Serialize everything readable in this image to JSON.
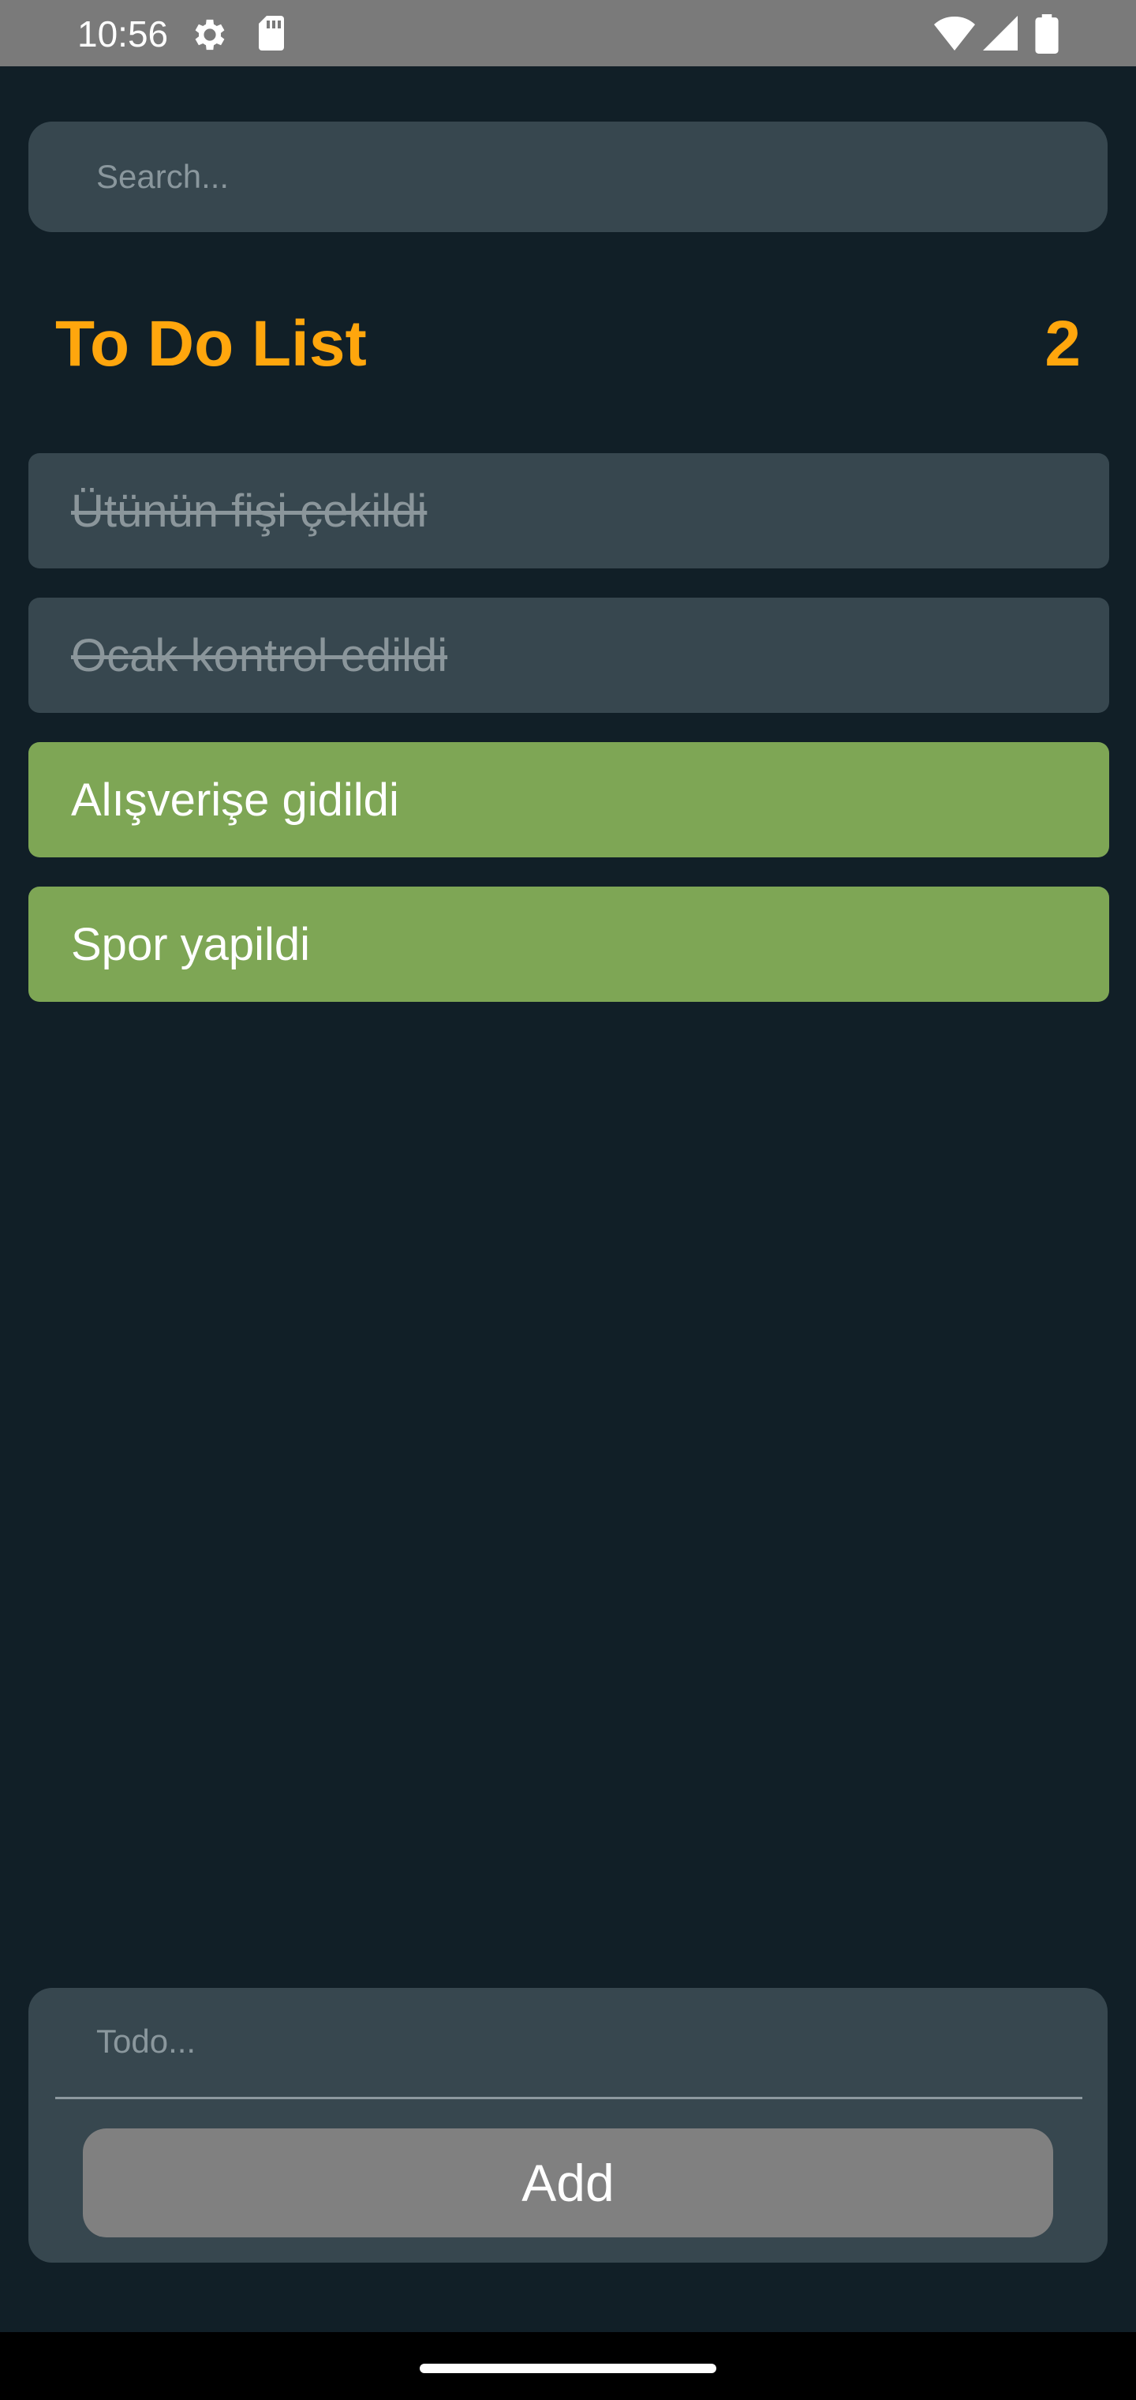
{
  "status_bar": {
    "time": "10:56",
    "icons": [
      "gear-icon",
      "sd-card-icon",
      "wifi-icon",
      "signal-icon",
      "battery-icon"
    ]
  },
  "search": {
    "placeholder": "Search..."
  },
  "heading": {
    "title": "To Do List",
    "count": "2"
  },
  "todos": [
    {
      "text": "Ütünün fişi çekildi",
      "completed": true
    },
    {
      "text": "Ocak kontrol edildi",
      "completed": true
    },
    {
      "text": "Alışverişe gidildi",
      "completed": false
    },
    {
      "text": "Spor yapildi",
      "completed": false
    }
  ],
  "add_form": {
    "placeholder": "Todo...",
    "button_label": "Add"
  },
  "colors": {
    "background": "#111f27",
    "card": "#37474f",
    "accent": "#ffa60d",
    "active_item": "#7ea655",
    "button": "#808080"
  }
}
